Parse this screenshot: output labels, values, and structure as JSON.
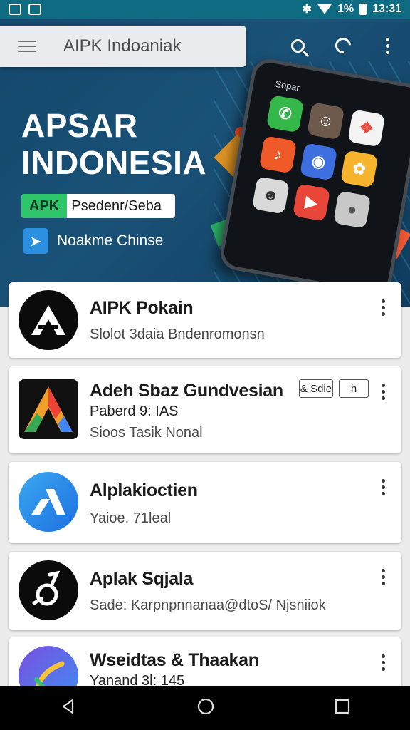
{
  "status_bar": {
    "battery_percent": "1%",
    "time": "13:31"
  },
  "search_bar": {
    "title": "AIPK Indoaniak"
  },
  "hero": {
    "title_line1": "APSAR",
    "title_line2": "INDONESIA",
    "apk_tag": "APK",
    "apk_text": "Psedenr/Seba",
    "subtitle": "Noakme Chinse",
    "phone_label": "Sopar"
  },
  "apps": [
    {
      "title": "AIPK Pokain",
      "line1": "Slolot 3daia Bndenromonsn"
    },
    {
      "title": "Adeh Sbaz Gundvesian",
      "line1": "Paberd 9: IAS",
      "line2": "Sioos Tasik Nonal",
      "badge1": "& Sdie",
      "badge2": "h"
    },
    {
      "title": "Alplakioctien",
      "line1": "Yaioe. 71leal"
    },
    {
      "title": "Aplak Sqjala",
      "line1": "Sade: Karpnpnnanaa@dtoS/ Njsniiok"
    },
    {
      "title": "Wseidtas & Thaakan",
      "line1": "Yanand 3l: 145"
    }
  ],
  "colors": {
    "status_bar": "#0f6b82",
    "hero_bg": "#14486d",
    "apk_green": "#2fc66b",
    "nav_bar": "#000000"
  }
}
